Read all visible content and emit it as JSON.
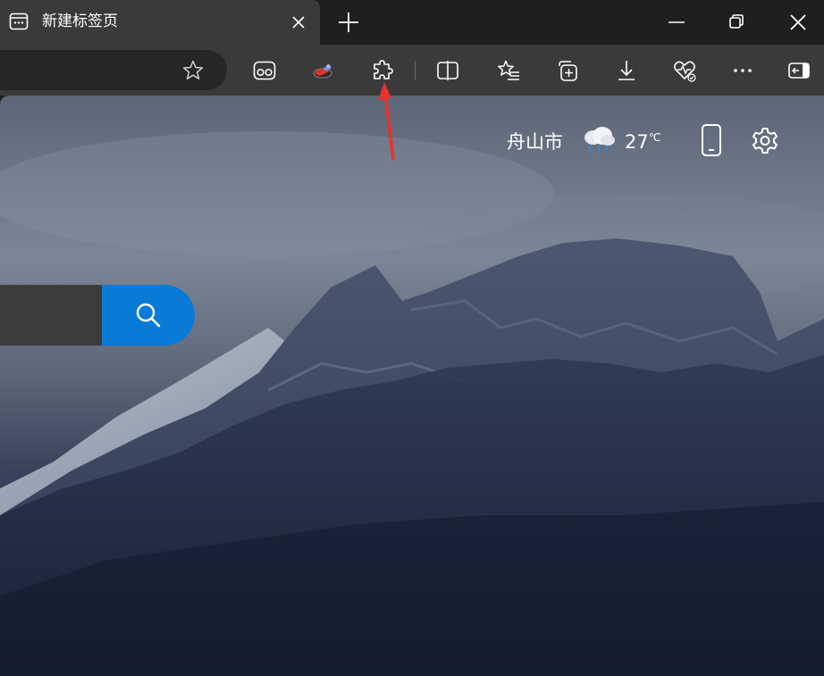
{
  "tab": {
    "title": "新建标签页",
    "icon": "new-tab-page-icon"
  },
  "titlebar": {
    "new_tab_icon": "plus-icon",
    "window_buttons": [
      "minimize-icon",
      "restore-icon",
      "close-icon"
    ]
  },
  "toolbar": {
    "icons": [
      "favorite-star-icon",
      "reading-mode-icon",
      "extension-app-icon",
      "extensions-puzzle-icon",
      "split-screen-icon",
      "favorites-list-icon",
      "collections-icon",
      "download-icon",
      "browser-essentials-icon",
      "more-icon",
      "sidebar-icon"
    ]
  },
  "weather": {
    "city": "舟山市",
    "temperature": "27",
    "unit": "℃",
    "condition_icon": "rain-cloud-icon"
  },
  "colors": {
    "tab_bg": "#3a3a3a",
    "titlebar_bg": "#1f1f1f",
    "address_bg": "#262626",
    "search_button": "#0a7ad8",
    "search_input": "#3c3c3d",
    "annotation": "#e8322b"
  }
}
